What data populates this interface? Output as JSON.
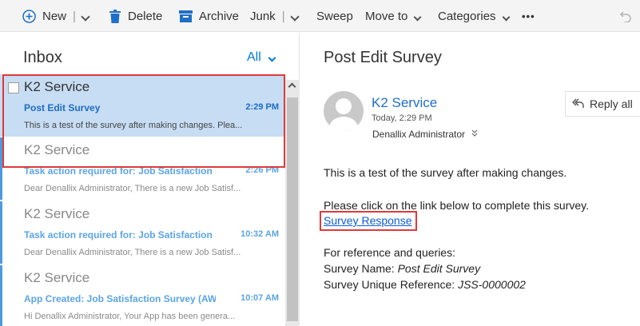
{
  "toolbar": {
    "new_label": "New",
    "delete_label": "Delete",
    "archive_label": "Archive",
    "junk_label": "Junk",
    "sweep_label": "Sweep",
    "move_label": "Move to",
    "categories_label": "Categories",
    "more_label": "•••"
  },
  "inbox": {
    "title": "Inbox",
    "filter_label": "All",
    "messages": [
      {
        "sender": "K2 Service",
        "subject": "Post Edit Survey",
        "time": "2:29 PM",
        "preview": "This is a test of the survey after making changes. Plea..."
      },
      {
        "sender": "K2 Service",
        "subject": "Task action required for: Job Satisfaction Su",
        "time": "2:26 PM",
        "preview": "Dear Denallix Administrator, There is a new Job Satisf..."
      },
      {
        "sender": "K2 Service",
        "subject": "Task action required for: Job Satisfaction Su",
        "time": "10:32 AM",
        "preview": "Dear Denallix Administrator, There is a new Job Satisf..."
      },
      {
        "sender": "K2 Service",
        "subject": "App Created: Job Satisfaction Survey (AWS-",
        "time": "10:07 AM",
        "preview": "Hi Denallix Administrator, Your App has been genera..."
      }
    ]
  },
  "email": {
    "subject": "Post Edit Survey",
    "from": "K2 Service",
    "date": "Today, 2:29 PM",
    "to": "Denallix Administrator",
    "reply_all_label": "Reply all",
    "body_line1": "This is a test of the survey after making changes.",
    "body_line2": "Please click on the link below to complete this survey.",
    "link_text": "Survey Response",
    "ref_heading": "For reference and queries:",
    "survey_name_label": "Survey Name: ",
    "survey_name_value": "Post Edit Survey",
    "survey_ref_label": "Survey Unique Reference: ",
    "survey_ref_value": "JSS-0000002"
  },
  "colors": {
    "accent": "#0078d7",
    "selected_bg": "#c7ddf3",
    "highlight_outline": "#e03a3a",
    "unread_bar": "#4c9ae0"
  }
}
